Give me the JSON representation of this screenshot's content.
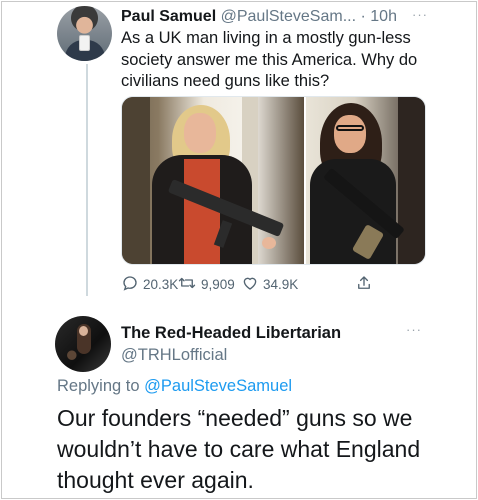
{
  "tweet1": {
    "name": "Paul Samuel",
    "handle": "@PaulSteveSam...",
    "dot": "·",
    "time": "10h",
    "more": "···",
    "text": "As a UK man living in a mostly gun-less society answer me this America. Why do civilians need guns like this?",
    "stats": {
      "replies": "20.3K",
      "retweets": "9,909",
      "likes": "34.9K"
    }
  },
  "tweet2": {
    "name": "The Red-Headed Libertarian",
    "handle": "@TRHLofficial",
    "more": "···",
    "replying_prefix": "Replying to ",
    "replying_to": "@PaulSteveSamuel",
    "text": "Our founders “needed” guns so we wouldn’t have to care what England thought ever again."
  },
  "colors": {
    "text": "#14171a",
    "secondary": "#657786",
    "link": "#1d9bf0"
  }
}
